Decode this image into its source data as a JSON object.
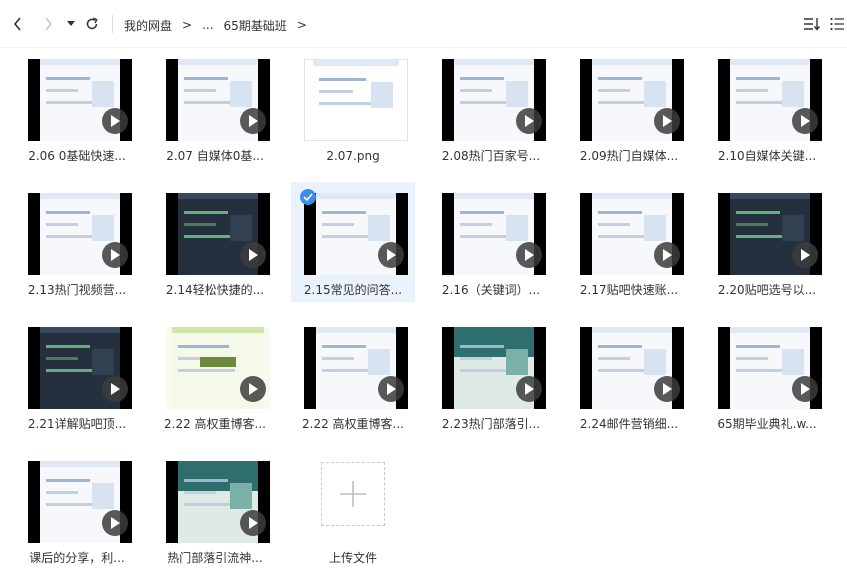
{
  "toolbar": {
    "back_icon": "chevron-left-icon",
    "forward_icon": "chevron-right-icon",
    "dropdown_icon": "caret-down-icon",
    "refresh_icon": "refresh-icon",
    "sort_icon": "sort-icon",
    "view_icon": "list-view-icon",
    "breadcrumb": [
      "我的网盘",
      "...",
      "65期基础班"
    ],
    "separator": ">"
  },
  "colors": {
    "accent": "#3a8ee6",
    "selected_bg": "#eaf3fd"
  },
  "files": [
    {
      "name": "2.06 0基础快速...",
      "type": "video",
      "style": "light"
    },
    {
      "name": "2.07 自媒体0基...",
      "type": "video",
      "style": "light"
    },
    {
      "name": "2.07.png",
      "type": "image",
      "style": "image"
    },
    {
      "name": "2.08热门百家号...",
      "type": "video",
      "style": "light"
    },
    {
      "name": "2.09热门自媒体...",
      "type": "video",
      "style": "light"
    },
    {
      "name": "2.10自媒体关键...",
      "type": "video",
      "style": "light"
    },
    {
      "name": "2.13热门视频营...",
      "type": "video",
      "style": "light"
    },
    {
      "name": "2.14轻松快捷的...",
      "type": "video",
      "style": "dark"
    },
    {
      "name": "2.15常见的问答...",
      "type": "video",
      "style": "light",
      "selected": true
    },
    {
      "name": "2.16（关键词）...",
      "type": "video",
      "style": "light"
    },
    {
      "name": "2.17贴吧快速账...",
      "type": "video",
      "style": "light"
    },
    {
      "name": "2.20贴吧选号以...",
      "type": "video",
      "style": "dark"
    },
    {
      "name": "2.21详解贴吧顶...",
      "type": "video",
      "style": "dark"
    },
    {
      "name": "2.22 高权重博客...",
      "type": "video",
      "style": "mind"
    },
    {
      "name": "2.22 高权重博客...",
      "type": "video",
      "style": "light"
    },
    {
      "name": "2.23热门部落引...",
      "type": "video",
      "style": "green"
    },
    {
      "name": "2.24邮件营销细...",
      "type": "video",
      "style": "light"
    },
    {
      "name": "65期毕业典礼.w...",
      "type": "video",
      "style": "light"
    },
    {
      "name": "课后的分享，利...",
      "type": "video",
      "style": "light"
    },
    {
      "name": "热门部落引流神...",
      "type": "video",
      "style": "green"
    }
  ],
  "upload": {
    "label": "上传文件",
    "icon": "plus-icon"
  }
}
